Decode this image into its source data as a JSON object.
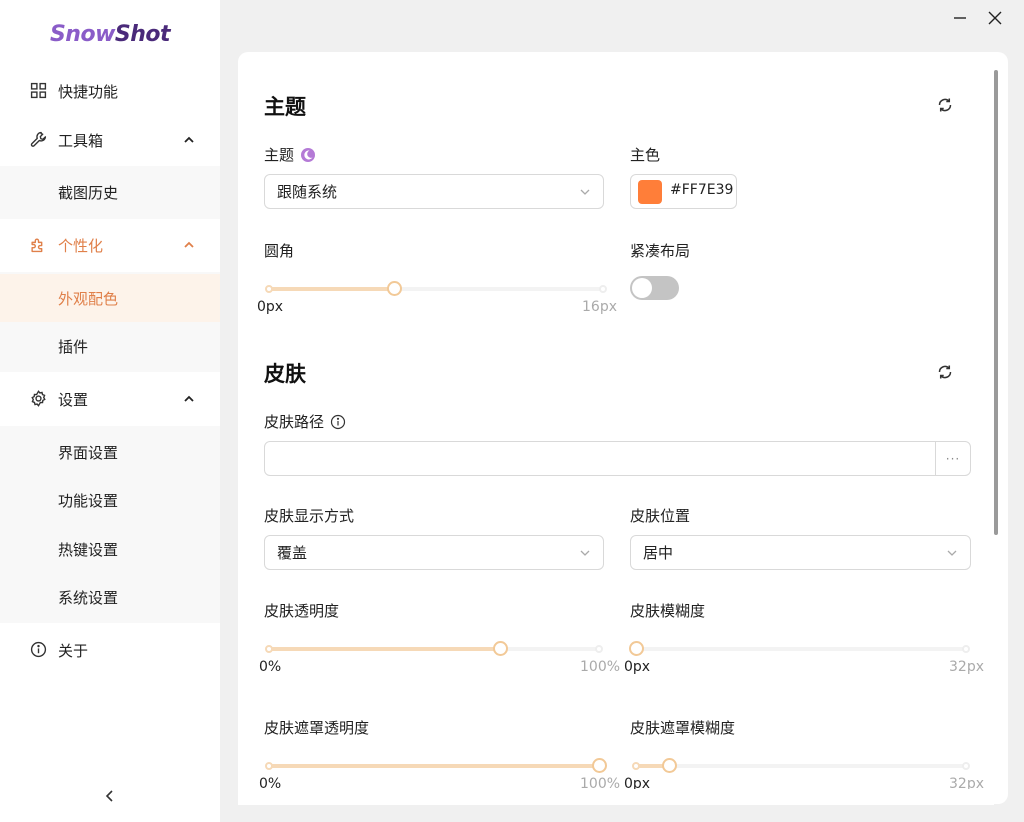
{
  "app": {
    "logo_part1": "Snow",
    "logo_part2": "Shot"
  },
  "sidebar": {
    "items": [
      {
        "label": "快捷功能"
      },
      {
        "label": "工具箱",
        "children": [
          {
            "label": "截图历史"
          }
        ]
      },
      {
        "label": "个性化",
        "children": [
          {
            "label": "外观配色"
          },
          {
            "label": "插件"
          }
        ]
      },
      {
        "label": "设置",
        "children": [
          {
            "label": "界面设置"
          },
          {
            "label": "功能设置"
          },
          {
            "label": "热键设置"
          },
          {
            "label": "系统设置"
          }
        ]
      },
      {
        "label": "关于"
      }
    ]
  },
  "theme_section": {
    "title": "主题",
    "theme_label": "主题",
    "theme_value": "跟随系统",
    "primary_color_label": "主色",
    "primary_color_value": "#FF7E39",
    "primary_color": "#FF7E39",
    "radius_label": "圆角",
    "radius_min": "0px",
    "radius_max": "16px",
    "radius_value_fraction": 0.375,
    "compact_label": "紧凑布局",
    "compact_on": false
  },
  "skin_section": {
    "title": "皮肤",
    "path_label": "皮肤路径",
    "path_value": "",
    "path_button": "···",
    "display_mode_label": "皮肤显示方式",
    "display_mode_value": "覆盖",
    "position_label": "皮肤位置",
    "position_value": "居中",
    "opacity_label": "皮肤透明度",
    "opacity_min": "0%",
    "opacity_max": "100%",
    "opacity_value_fraction": 0.7,
    "blur_label": "皮肤模糊度",
    "blur_min": "0px",
    "blur_max": "32px",
    "blur_value_fraction": 0.0,
    "mask_opacity_label": "皮肤遮罩透明度",
    "mask_opacity_min": "0%",
    "mask_opacity_max": "100%",
    "mask_opacity_value_fraction": 1.0,
    "mask_blur_label": "皮肤遮罩模糊度",
    "mask_blur_min": "0px",
    "mask_blur_max": "32px",
    "mask_blur_value_fraction": 0.1
  },
  "colors": {
    "accent": "#E0804A",
    "brand_purple": "#8A5CC8",
    "slider_fill": "#F6D9B7"
  }
}
